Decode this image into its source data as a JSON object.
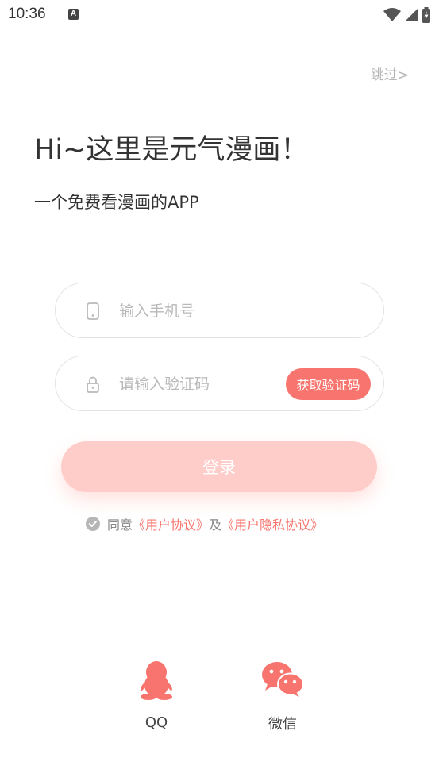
{
  "status_bar": {
    "time": "10:36",
    "notification_icon": "A"
  },
  "skip": {
    "label": "跳过>"
  },
  "headline": "Hi~这里是元气漫画！",
  "subheadline": "一个免费看漫画的APP",
  "phone_field": {
    "placeholder": "输入手机号",
    "icon": "phone-icon"
  },
  "code_field": {
    "placeholder": "请输入验证码",
    "icon": "lock-icon",
    "button_label": "获取验证码"
  },
  "login": {
    "label": "登录"
  },
  "agreement": {
    "prefix": "同意",
    "user_agreement": "《用户协议》",
    "conjunction": "及",
    "privacy_agreement": "《用户隐私协议》"
  },
  "social_login": [
    {
      "label": "QQ",
      "icon": "qq-penguin-icon"
    },
    {
      "label": "微信",
      "icon": "wechat-icon"
    }
  ],
  "colors": {
    "accent": "#f7756e",
    "login_disabled": "#ffcdc9",
    "placeholder": "#b8b8b8",
    "skip": "#b5b5b5"
  }
}
